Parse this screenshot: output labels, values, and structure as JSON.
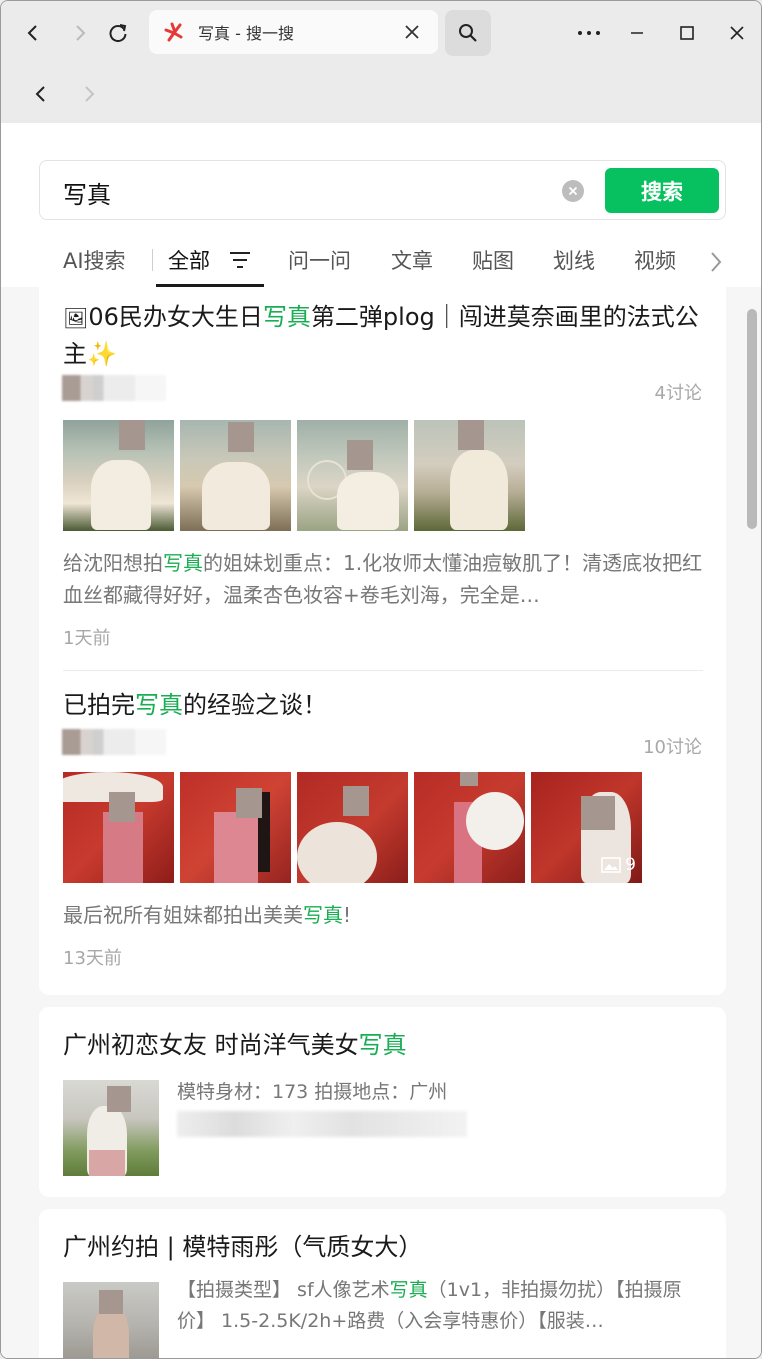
{
  "browser": {
    "tab_title": "写真 - 搜一搜"
  },
  "search": {
    "query": "写真",
    "submit_label": "搜索"
  },
  "filters": [
    "AI搜索",
    "全部",
    "问一问",
    "文章",
    "贴图",
    "划线",
    "视频"
  ],
  "results": {
    "r1": {
      "title_prefix": "06民办女大生日",
      "title_highlight": "写真",
      "title_suffix": "第二弹plog｜闯进莫奈画里的法式公主✨",
      "comments": "4讨论",
      "desc_prefix": "给沈阳想拍",
      "desc_highlight": "写真",
      "desc_suffix": "的姐妹划重点：1.化妆师太懂油痘敏肌了！清透底妆把红血丝都藏得好好，温柔杏色妆容+卷毛刘海，完全是…",
      "time": "1天前"
    },
    "r2": {
      "title_prefix": "已拍完",
      "title_highlight": "写真",
      "title_suffix": "的经验之谈！",
      "comments": "10讨论",
      "image_count": "9",
      "desc_prefix": "最后祝所有姐妹都拍出美美",
      "desc_highlight": "写真",
      "desc_suffix": "!",
      "time": "13天前"
    },
    "r3": {
      "title_prefix": "广州初恋女友 时尚洋气美女",
      "title_highlight": "写真",
      "info": "模特身材：173 拍摄地点：广州"
    },
    "r4": {
      "title": "广州约拍 | 模特雨彤（气质女大）",
      "desc_prefix": "【拍摄类型】 sf人像艺术",
      "desc_highlight": "写真",
      "desc_suffix": "（1v1，非拍摄勿扰）【拍摄原价】 1.5-2.5K/2h+路费（入会享特惠价）【服装…"
    }
  },
  "colors": {
    "accent": "#07c160",
    "highlight": "#1aad54"
  }
}
